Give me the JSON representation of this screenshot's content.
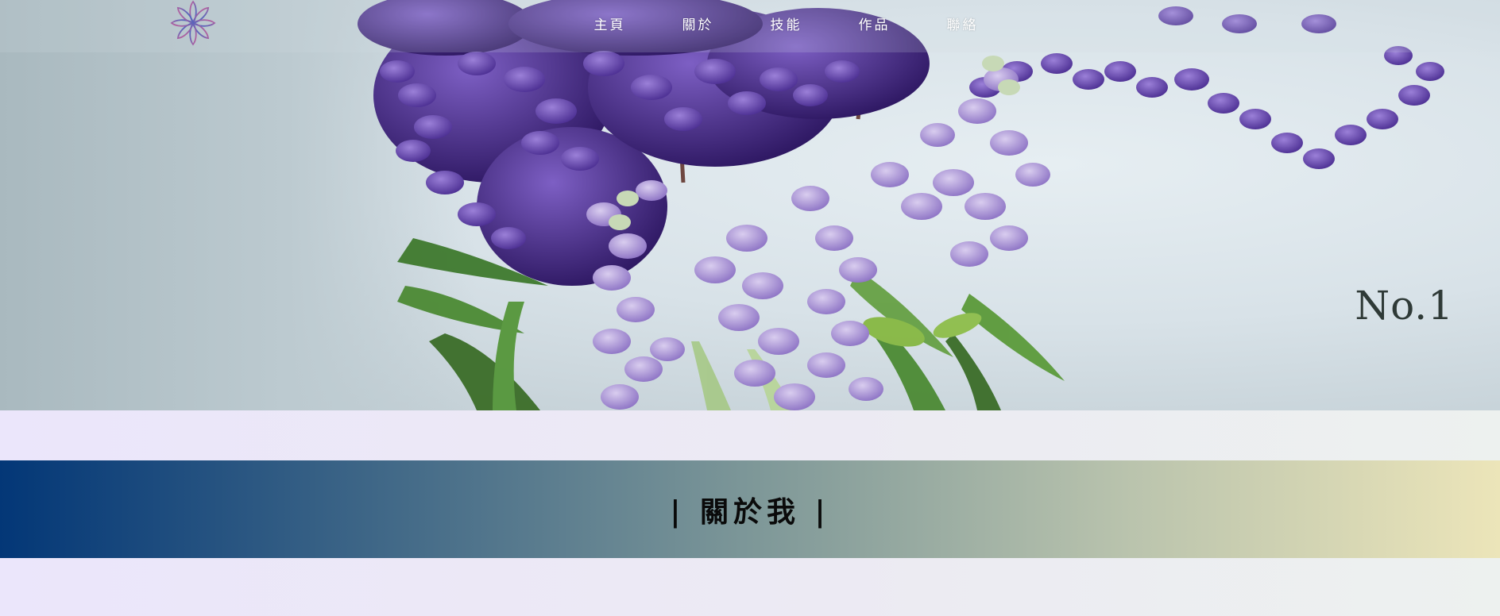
{
  "nav": {
    "items": [
      {
        "label": "主頁"
      },
      {
        "label": "關於"
      },
      {
        "label": "技能"
      },
      {
        "label": "作品"
      },
      {
        "label": "聯絡"
      }
    ]
  },
  "logo": {
    "icon": "lotus-flower-icon"
  },
  "hero": {
    "image": "purple-lupine-flowers-photo",
    "number": "No.1"
  },
  "about": {
    "title": "| 關於我 |"
  },
  "colors": {
    "header_gradient": [
      "#033777",
      "#7d9798",
      "#ece5b9"
    ],
    "background": "#ece8f7",
    "hero_number": "#2f3a37"
  }
}
